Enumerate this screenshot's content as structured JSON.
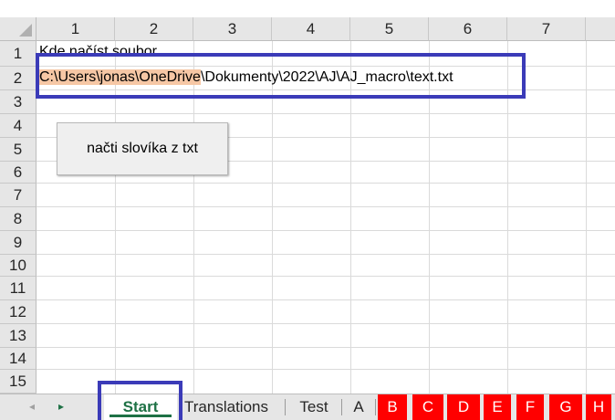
{
  "columns": [
    "1",
    "2",
    "3",
    "4",
    "5",
    "6",
    "7"
  ],
  "rows": [
    "1",
    "2",
    "3",
    "4",
    "5",
    "6",
    "7",
    "8",
    "9",
    "10",
    "11",
    "12",
    "13",
    "14",
    "15"
  ],
  "cells": {
    "a1": "Kde načíst soubor",
    "a2_highlight": "C:\\Users\\jonas\\OneDrive",
    "a2_rest": "\\Dokumenty\\2022\\AJ\\AJ_macro\\text.txt"
  },
  "button": {
    "label": "načti slovíka z txt"
  },
  "tabs": {
    "start": "Start",
    "translations": "Translations",
    "test": "Test",
    "a": "A",
    "b": "B",
    "c": "C",
    "d": "D",
    "e": "E",
    "f": "F",
    "g": "G",
    "h": "H"
  },
  "colors": {
    "highlight": "#f6c7a5",
    "annotation_box": "#3b3bb8",
    "active_tab": "#1e7145",
    "red_tab": "#ff0000"
  }
}
